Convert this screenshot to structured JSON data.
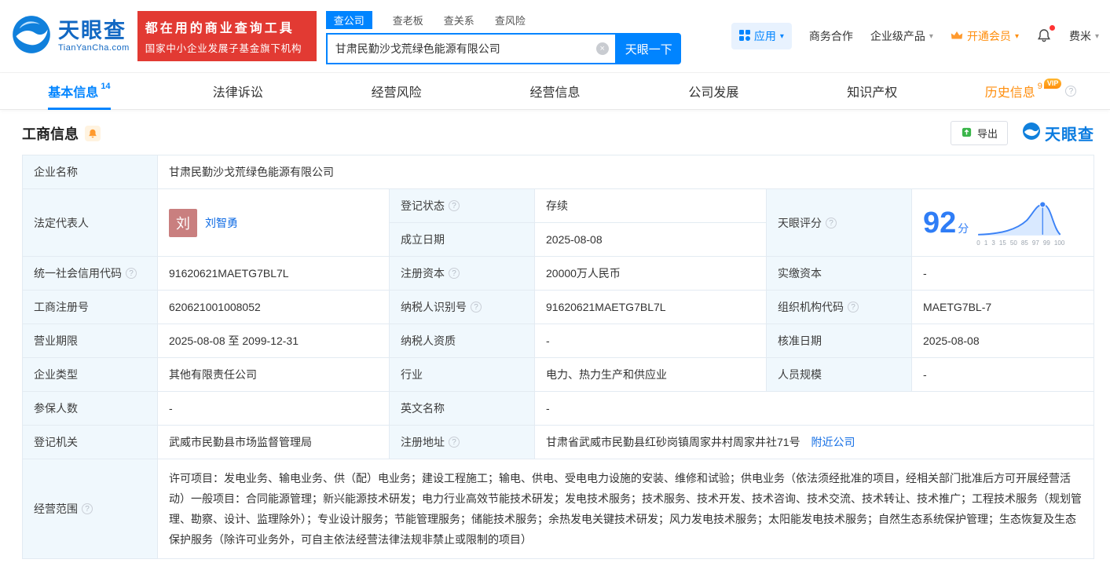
{
  "colors": {
    "accent": "#0084ff",
    "link": "#126de4",
    "green": "#00a971",
    "orange": "#ff8e0d",
    "red": "#e23a33",
    "score": "#2f7df6"
  },
  "icons": {
    "help": "?",
    "caret": "▾",
    "clear": "×"
  },
  "brand": {
    "name": "天眼查",
    "domain": "TianYanCha.com",
    "promo_line1": "都在用的商业查询工具",
    "promo_line2": "国家中小企业发展子基金旗下机构"
  },
  "search": {
    "tabs": [
      {
        "label": "查公司"
      },
      {
        "label": "查老板"
      },
      {
        "label": "查关系"
      },
      {
        "label": "查风险"
      }
    ],
    "value": "甘肃民勤沙戈荒绿色能源有限公司",
    "button": "天眼一下"
  },
  "header_menu": {
    "apps": "应用",
    "cooperation": "商务合作",
    "enterprise": "企业级产品",
    "vip": "开通会员",
    "user": "费米"
  },
  "nav_tabs": [
    {
      "label": "基本信息",
      "count": "14"
    },
    {
      "label": "法律诉讼"
    },
    {
      "label": "经营风险"
    },
    {
      "label": "经营信息"
    },
    {
      "label": "公司发展"
    },
    {
      "label": "知识产权"
    },
    {
      "label": "历史信息",
      "count": "9",
      "vip_badge": "VIP"
    }
  ],
  "section": {
    "title": "工商信息",
    "export": "导出",
    "watermark": "天眼查"
  },
  "fields": {
    "company_name": {
      "label": "企业名称",
      "value": "甘肃民勤沙戈荒绿色能源有限公司"
    },
    "legal_rep": {
      "label": "法定代表人",
      "value": "刘智勇",
      "avatar": "刘"
    },
    "reg_status": {
      "label": "登记状态",
      "value": "存续"
    },
    "establish_date": {
      "label": "成立日期",
      "value": "2025-08-08"
    },
    "score": {
      "label": "天眼评分",
      "value": "92",
      "unit": "分",
      "axis": [
        "0",
        "1",
        "3",
        "15",
        "50",
        "85",
        "97",
        "99",
        "100"
      ]
    },
    "credit_code": {
      "label": "统一社会信用代码",
      "value": "91620621MAETG7BL7L"
    },
    "reg_capital": {
      "label": "注册资本",
      "value": "20000万人民币"
    },
    "paid_capital": {
      "label": "实缴资本",
      "value": "-"
    },
    "reg_number": {
      "label": "工商注册号",
      "value": "620621001008052"
    },
    "taxpayer_id": {
      "label": "纳税人识别号",
      "value": "91620621MAETG7BL7L"
    },
    "org_code": {
      "label": "组织机构代码",
      "value": "MAETG7BL-7"
    },
    "business_term": {
      "label": "营业期限",
      "value": "2025-08-08 至 2099-12-31"
    },
    "taxpayer_quality": {
      "label": "纳税人资质",
      "value": "-"
    },
    "approval_date": {
      "label": "核准日期",
      "value": "2025-08-08"
    },
    "company_type": {
      "label": "企业类型",
      "value": "其他有限责任公司"
    },
    "industry": {
      "label": "行业",
      "value": "电力、热力生产和供应业"
    },
    "staff_size": {
      "label": "人员规模",
      "value": "-"
    },
    "insured_count": {
      "label": "参保人数",
      "value": "-"
    },
    "english_name": {
      "label": "英文名称",
      "value": "-"
    },
    "reg_authority": {
      "label": "登记机关",
      "value": "武威市民勤县市场监督管理局"
    },
    "reg_address": {
      "label": "注册地址",
      "value": "甘肃省武威市民勤县红砂岗镇周家井村周家井社71号",
      "link": "附近公司"
    },
    "business_scope": {
      "label": "经营范围",
      "value": "许可项目：发电业务、输电业务、供（配）电业务；建设工程施工；输电、供电、受电电力设施的安装、维修和试验；供电业务（依法须经批准的项目，经相关部门批准后方可开展经营活动）一般项目：合同能源管理；新兴能源技术研发；电力行业高效节能技术研发；发电技术服务；技术服务、技术开发、技术咨询、技术交流、技术转让、技术推广；工程技术服务（规划管理、勘察、设计、监理除外）；专业设计服务；节能管理服务；储能技术服务；余热发电关键技术研发；风力发电技术服务；太阳能发电技术服务；自然生态系统保护管理；生态恢复及生态保护服务（除许可业务外，可自主依法经营法律法规非禁止或限制的项目）"
    }
  }
}
